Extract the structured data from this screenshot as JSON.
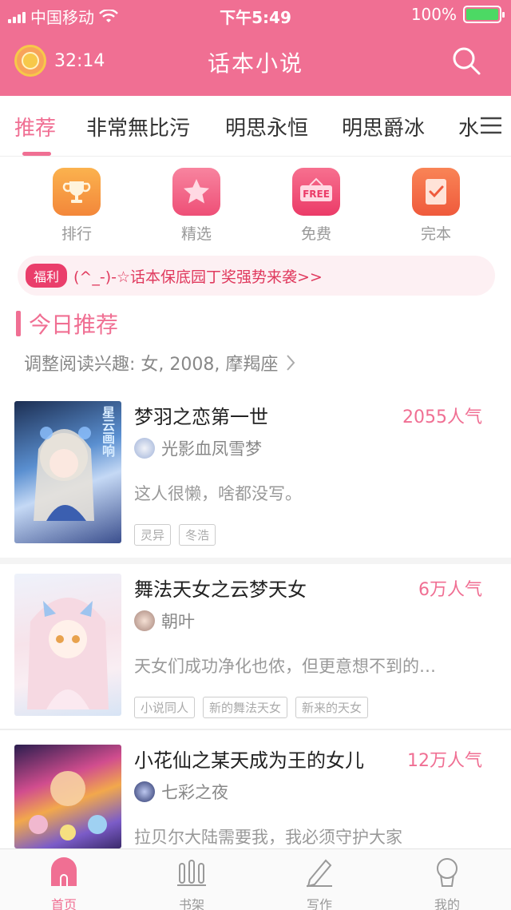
{
  "status": {
    "carrier": "中国移动",
    "time": "下午5:49",
    "battery_pct": "100%",
    "battery_level": 1.0
  },
  "header": {
    "timer": "32:14",
    "title": "话本小说"
  },
  "tabs": [
    {
      "label": "推荐",
      "active": true
    },
    {
      "label": "非常無比污"
    },
    {
      "label": "明思永恒"
    },
    {
      "label": "明思爵冰"
    },
    {
      "label": "水"
    }
  ],
  "quick": [
    {
      "label": "排行",
      "icon": "trophy-icon",
      "color": "#f89a3c"
    },
    {
      "label": "精选",
      "icon": "star-icon",
      "color": "#f4678b"
    },
    {
      "label": "免费",
      "icon": "free-sign-icon",
      "color": "#f04f7a"
    },
    {
      "label": "完本",
      "icon": "finished-book-icon",
      "color": "#f46a3e"
    }
  ],
  "notice": {
    "badge": "福利",
    "text": "(^_-)-☆话本保底园丁奖强势来袭>>"
  },
  "section": {
    "title": "今日推荐",
    "interest": "调整阅读兴趣: 女, 2008, 摩羯座"
  },
  "books": [
    {
      "title": "梦羽之恋第一世",
      "popularity": "2055人气",
      "author": "光影血凤雪梦",
      "desc": "这人很懒，啥都没写。",
      "tags": [
        "灵异",
        "冬浩"
      ],
      "cover_text": "星云画响"
    },
    {
      "title": "舞法天女之云梦天女",
      "popularity": "6万人气",
      "author": "朝叶",
      "desc": "天女们成功净化也侬，但更意想不到的…",
      "tags": [
        "小说同人",
        "新的舞法天女",
        "新来的天女"
      ]
    },
    {
      "title": "小花仙之某天成为王的女儿",
      "popularity": "12万人气",
      "author": "七彩之夜",
      "desc": "拉贝尔大陆需要我，我必须守护大家",
      "tags": []
    }
  ],
  "tabbar": [
    {
      "label": "首页",
      "icon": "home-icon",
      "active": true
    },
    {
      "label": "书架",
      "icon": "bookshelf-icon"
    },
    {
      "label": "写作",
      "icon": "pen-icon"
    },
    {
      "label": "我的",
      "icon": "profile-icon"
    }
  ],
  "colors": {
    "brand": "#f06f93",
    "notice_badge": "#ea3e6b",
    "notice_text": "#e03a5e"
  }
}
